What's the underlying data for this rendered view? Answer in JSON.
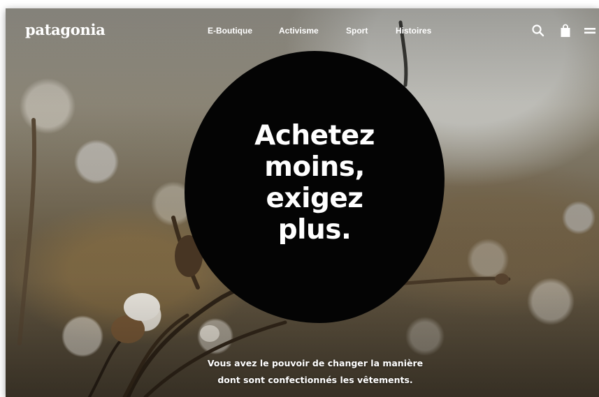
{
  "brand": {
    "logo_text": "patagonia"
  },
  "nav": {
    "items": [
      {
        "label": "E-Boutique"
      },
      {
        "label": "Activisme"
      },
      {
        "label": "Sport"
      },
      {
        "label": "Histoires"
      }
    ]
  },
  "header_icons": [
    "search-icon",
    "shopping-bag-icon",
    "menu-icon"
  ],
  "hero": {
    "headline_lines": [
      "Achetez",
      "moins,",
      "exigez",
      "plus."
    ],
    "subtext_lines": [
      "Vous avez le pouvoir de changer la manière",
      "dont sont confectionnés les vêtements."
    ]
  },
  "colors": {
    "blob": "#040404",
    "text": "#ffffff"
  }
}
